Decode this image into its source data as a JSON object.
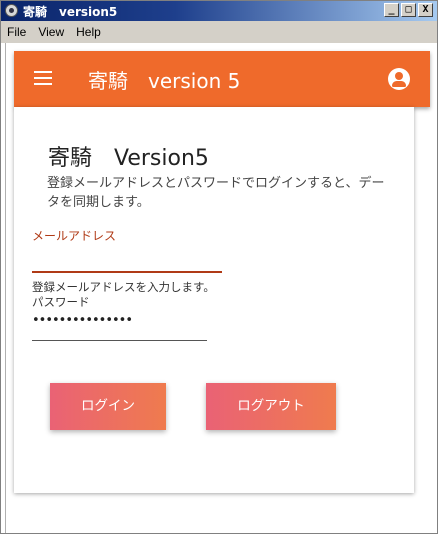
{
  "window": {
    "title": "寄騎　version5",
    "minimize": "_",
    "maximize": "□",
    "close": "X"
  },
  "menu": [
    "File",
    "View",
    "Help"
  ],
  "appbar": {
    "title": "寄騎　version 5",
    "color": "#ef6a2b"
  },
  "card": {
    "title": "寄騎　Version5",
    "description": "登録メールアドレスとパスワードでログインすると、データを同期します。",
    "email_label": "メールアドレス",
    "email_value": "",
    "email_helper": "登録メールアドレスを入力します。",
    "password_label": "パスワード",
    "password_value": "•••••••••••••••",
    "login_button": "ログイン",
    "logout_button": "ログアウト"
  },
  "colors": {
    "accent": "#ef6a2b",
    "label": "#b03a16",
    "button_start": "#ea6275",
    "button_end": "#ef7b4e"
  }
}
